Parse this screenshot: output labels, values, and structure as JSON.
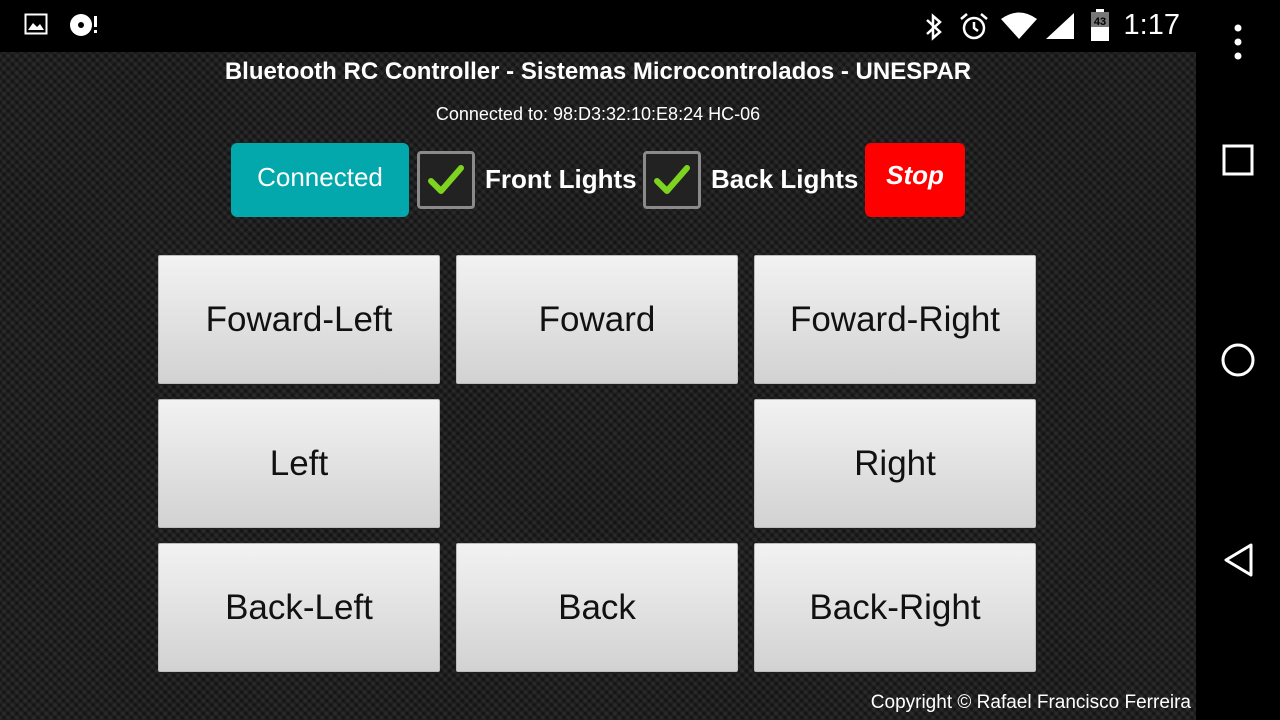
{
  "status_bar": {
    "time": "1:17",
    "battery_level": "43",
    "left_icons": [
      "gallery-icon",
      "media-disc-icon"
    ],
    "right_icons": [
      "bluetooth-icon",
      "alarm-icon",
      "wifi-icon",
      "cellular-signal-icon",
      "battery-icon"
    ]
  },
  "app": {
    "title": "Bluetooth RC Controller - Sistemas Microcontrolados - UNESPAR",
    "connection_info": "Connected to: 98:D3:32:10:E8:24 HC-06"
  },
  "controls": {
    "connect_label": "Connected",
    "front_lights_label": "Front Lights",
    "front_lights_checked": true,
    "back_lights_label": "Back Lights",
    "back_lights_checked": true,
    "stop_label": "Stop"
  },
  "pad": {
    "forward_left": "Foward-Left",
    "forward": "Foward",
    "forward_right": "Foward-Right",
    "left": "Left",
    "right": "Right",
    "back_left": "Back-Left",
    "back": "Back",
    "back_right": "Back-Right"
  },
  "footer": {
    "copyright": "Copyright © Rafael Francisco Ferreira"
  },
  "nav_bar": [
    "overflow-menu-icon",
    "recents-icon",
    "home-icon",
    "back-icon"
  ],
  "colors": {
    "connect_button": "#03a8ac",
    "stop_button": "#ff0000",
    "checkmark": "#7ed321"
  }
}
